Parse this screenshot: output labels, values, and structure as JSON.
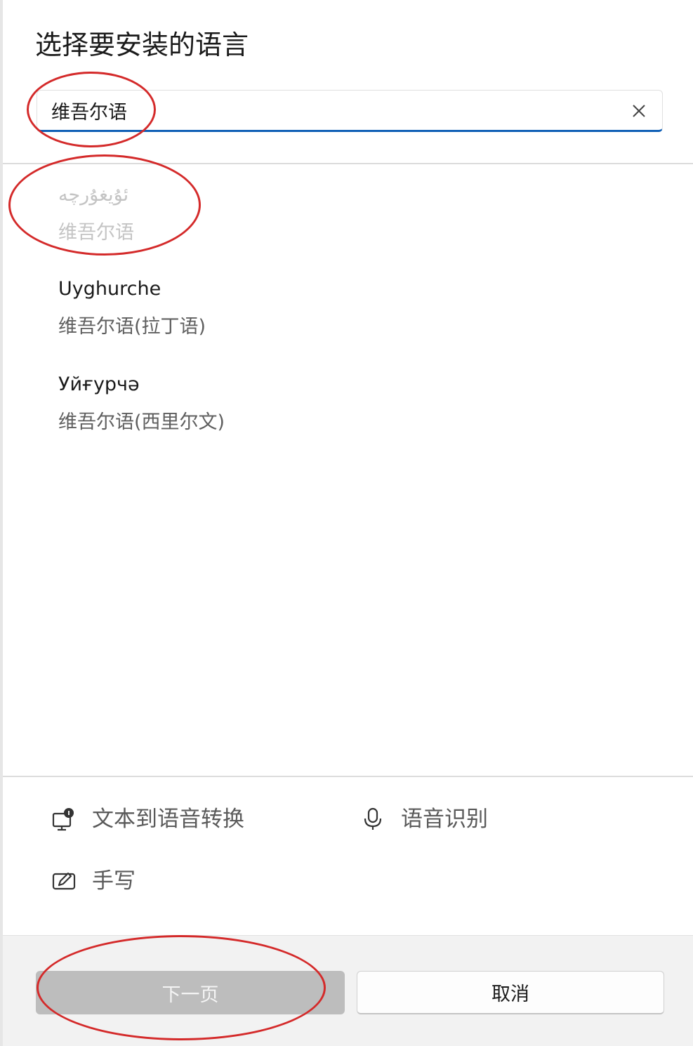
{
  "dialog": {
    "title": "选择要安装的语言"
  },
  "search": {
    "value": "维吾尔语",
    "placeholder": ""
  },
  "results": [
    {
      "native_name": "ئۇيغۇرچە",
      "localized_name": "维吾尔语",
      "state": "disabled"
    },
    {
      "native_name": "Uyghurche",
      "localized_name": "维吾尔语(拉丁语)",
      "state": "enabled"
    },
    {
      "native_name": "Уйғурчә",
      "localized_name": "维吾尔语(西里尔文)",
      "state": "enabled"
    }
  ],
  "features": {
    "tts": {
      "label": "文本到语音转换",
      "icon": "text-to-speech-icon"
    },
    "speech": {
      "label": "语音识别",
      "icon": "microphone-icon"
    },
    "handwriting": {
      "label": "手写",
      "icon": "handwriting-icon"
    }
  },
  "buttons": {
    "next_label": "下一页",
    "next_state": "disabled",
    "cancel_label": "取消"
  },
  "colors": {
    "accent": "#0f5fb6",
    "annotation": "#d42a2a",
    "disabled_button": "#bdbdbd",
    "footer_background": "#f2f2f2"
  }
}
